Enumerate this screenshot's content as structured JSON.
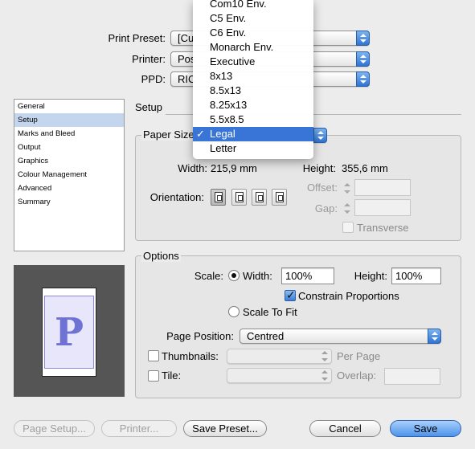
{
  "header": {
    "print_preset_label": "Print Preset:",
    "print_preset_value": "[Cu",
    "printer_label": "Printer:",
    "printer_value": "Pos",
    "ppd_label": "PPD:",
    "ppd_value": "RIC"
  },
  "sidebar": {
    "items": [
      {
        "label": "General"
      },
      {
        "label": "Setup"
      },
      {
        "label": "Marks and Bleed"
      },
      {
        "label": "Output"
      },
      {
        "label": "Graphics"
      },
      {
        "label": "Colour Management"
      },
      {
        "label": "Advanced"
      },
      {
        "label": "Summary"
      }
    ],
    "selected": "Setup",
    "preview_letter": "P"
  },
  "setup": {
    "title": "Setup",
    "paper_size_label": "Paper Size",
    "width_label": "Width:",
    "width_value": "215,9 mm",
    "height_label": "Height:",
    "height_value": "355,6 mm",
    "orientation_label": "Orientation:",
    "offset_label": "Offset:",
    "gap_label": "Gap:",
    "transverse_label": "Transverse",
    "orientation_icons": [
      "portrait-icon",
      "landscape-icon",
      "reverse-portrait-icon",
      "reverse-landscape-icon"
    ]
  },
  "options": {
    "title": "Options",
    "scale_label": "Scale:",
    "width_radio_label": "Width:",
    "width_value": "100%",
    "height_label": "Height:",
    "height_value": "100%",
    "constrain_label": "Constrain Proportions",
    "scale_to_fit_label": "Scale To Fit",
    "page_position_label": "Page Position:",
    "page_position_value": "Centred",
    "thumbnails_label": "Thumbnails:",
    "per_page_label": "Per Page",
    "tile_label": "Tile:",
    "overlap_label": "Overlap:"
  },
  "footer": {
    "page_setup": "Page Setup...",
    "printer": "Printer...",
    "save_preset": "Save Preset...",
    "cancel": "Cancel",
    "save": "Save"
  },
  "paper_menu": {
    "items": [
      "Com10 Env.",
      "C5 Env.",
      "C6 Env.",
      "Monarch Env.",
      "Executive",
      "8x13",
      "8.5x13",
      "8.25x13",
      "5.5x8.5",
      "Legal",
      "Letter"
    ],
    "selected": "Legal",
    "check_mark": "✓"
  },
  "colors": {
    "accent": "#3875d7",
    "list_selection": "#c3d6ee",
    "preview_background": "#555555"
  }
}
